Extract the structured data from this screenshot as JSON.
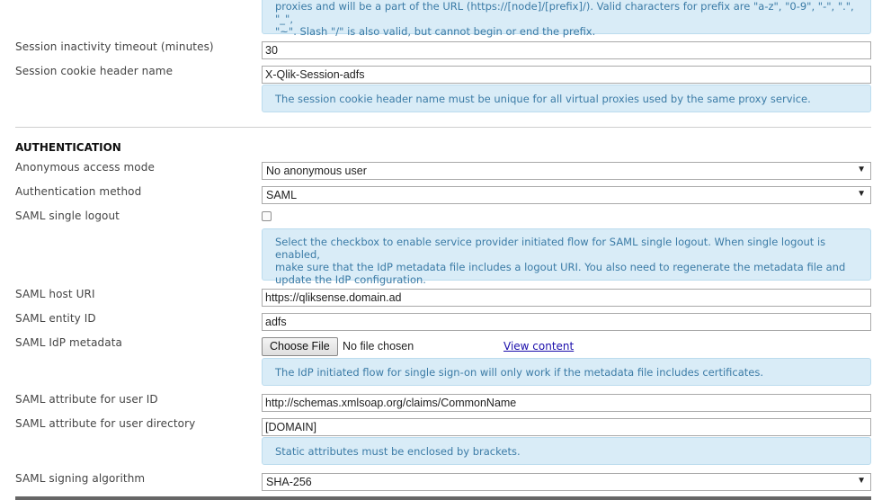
{
  "top_info": {
    "line1": "proxies and will be a part of the URL (https://[node]/[prefix]/). Valid characters for prefix are \"a-z\", \"0-9\", \"-\", \".\", \"_\",",
    "line2": "\"~\". Slash \"/\" is also valid, but cannot begin or end the prefix."
  },
  "session": {
    "timeout_label": "Session inactivity timeout (minutes)",
    "timeout_value": "30",
    "cookie_label": "Session cookie header name",
    "cookie_value": "X-Qlik-Session-adfs",
    "cookie_info": "The session cookie header name must be unique for all virtual proxies used by the same proxy service."
  },
  "authentication": {
    "heading": "AUTHENTICATION",
    "anon_label": "Anonymous access mode",
    "anon_value": "No anonymous user",
    "method_label": "Authentication method",
    "method_value": "SAML",
    "logout_label": "SAML single logout",
    "logout_checked": false,
    "logout_info_l1": "Select the checkbox to enable service provider initiated flow for SAML single logout. When single logout is enabled,",
    "logout_info_l2": "make sure that the IdP metadata file includes a logout URI. You also need to regenerate the metadata file and",
    "logout_info_l3": "update the IdP configuration.",
    "host_label": "SAML host URI",
    "host_value": "https://qliksense.domain.ad",
    "entity_label": "SAML entity ID",
    "entity_value": "adfs",
    "metadata_label": "SAML IdP metadata",
    "choose_file": "Choose File",
    "no_file": "No file chosen",
    "view_content": "View content",
    "metadata_info": "The IdP initiated flow for single sign-on will only work if the metadata file includes certificates.",
    "userid_label": "SAML attribute for user ID",
    "userid_value": "http://schemas.xmlsoap.org/claims/CommonName",
    "userdir_label": "SAML attribute for user directory",
    "userdir_value": "[DOMAIN]",
    "userdir_info": "Static attributes must be enclosed by brackets.",
    "signing_label": "SAML signing algorithm",
    "signing_value": "SHA-256"
  },
  "icons": {
    "dropdown_arrow": "▼"
  },
  "colors": {
    "info_bg": "#d9ecf7",
    "info_text": "#3b7ba6",
    "link": "#1a0dab"
  }
}
